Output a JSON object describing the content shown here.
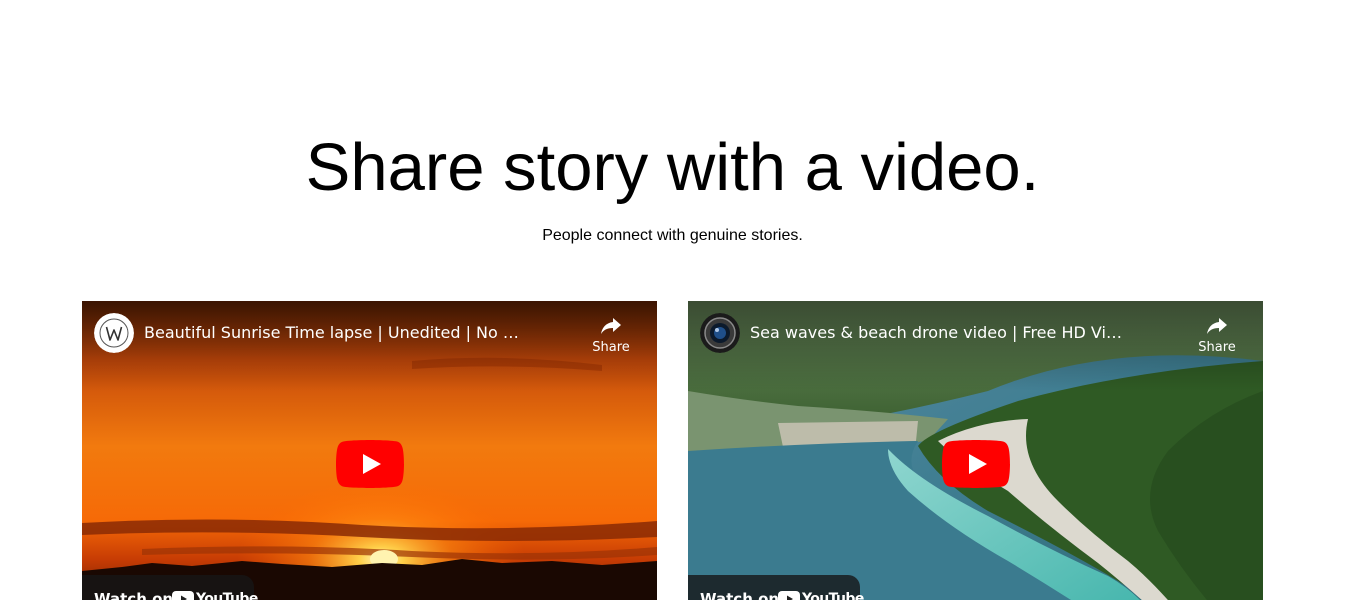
{
  "section": {
    "heading": "Share story with a video.",
    "subheading": "People connect with genuine stories."
  },
  "videos": [
    {
      "title": "Beautiful Sunrise Time lapse | Unedited | No Copyright Video",
      "channel_icon": "channel-w-icon",
      "share_label": "Share",
      "watch_on_label": "Watch on",
      "brand": "YouTube",
      "thumbnail": "sunrise-over-horizon"
    },
    {
      "title": "Sea waves & beach drone video | Free HD Video - no copyright",
      "channel_icon": "camera-lens-icon",
      "share_label": "Share",
      "watch_on_label": "Watch on",
      "brand": "YouTube",
      "thumbnail": "coastal-beach-aerial"
    }
  ],
  "colors": {
    "play_red": "#ff0000",
    "text": "#000000",
    "overlay_text": "#ffffff"
  }
}
